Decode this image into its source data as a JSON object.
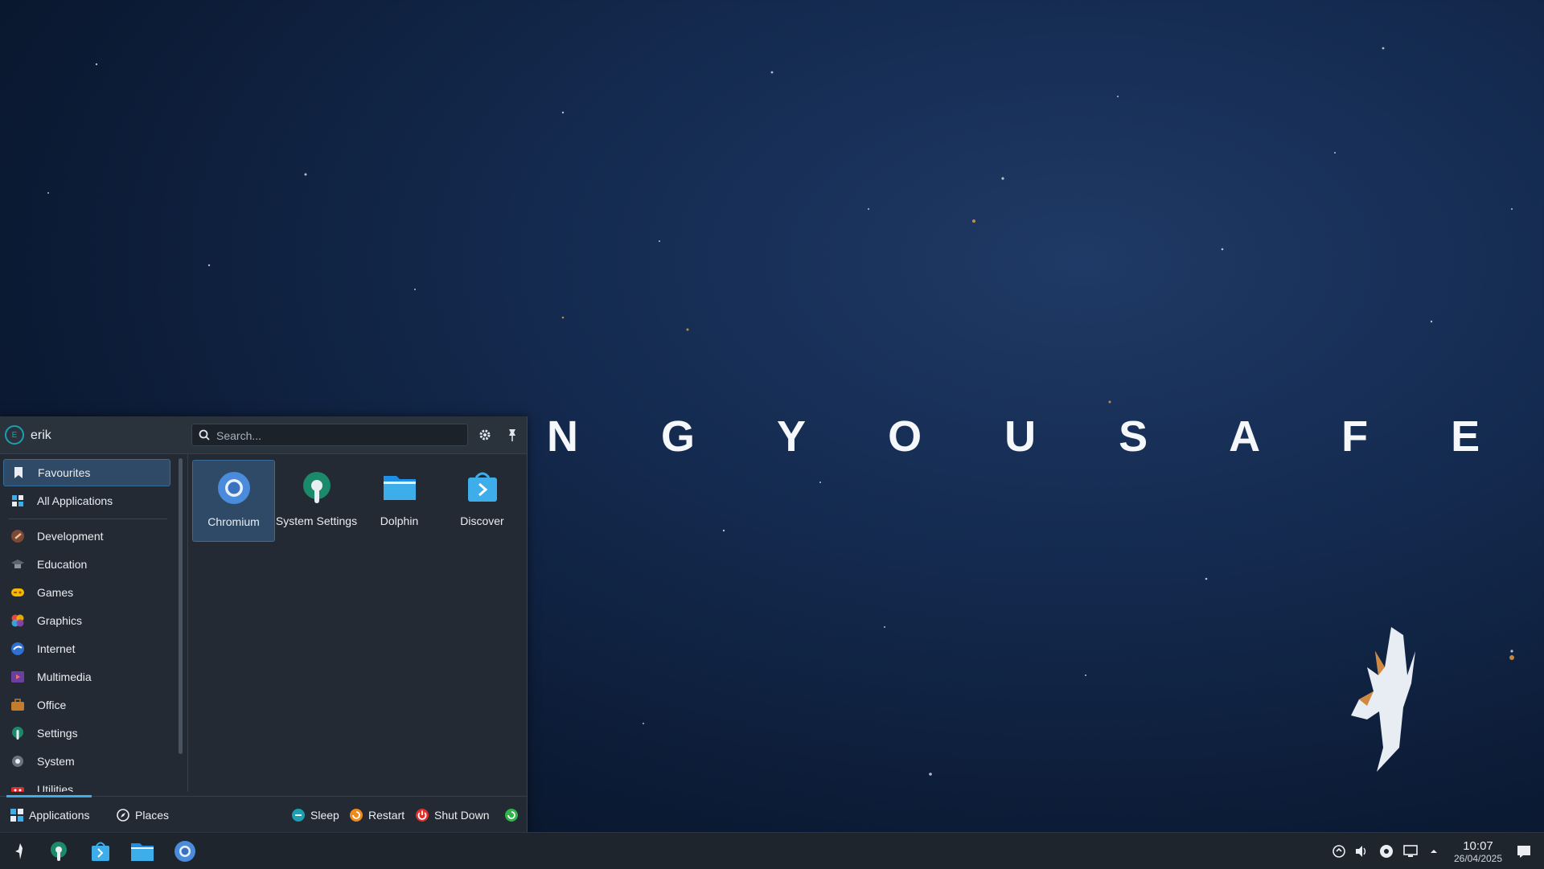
{
  "wallpaper": {
    "text": "N G   Y O U   S A F E"
  },
  "launcher": {
    "user": {
      "name": "erik",
      "avatar_initial": "E"
    },
    "search": {
      "placeholder": "Search..."
    },
    "categories": [
      {
        "label": "Favourites",
        "icon": "bookmark-icon",
        "active": true
      },
      {
        "label": "All Applications",
        "icon": "grid-icon"
      },
      {
        "label": "Development",
        "icon": "hammer-icon"
      },
      {
        "label": "Education",
        "icon": "graduation-cap-icon"
      },
      {
        "label": "Games",
        "icon": "gamepad-icon"
      },
      {
        "label": "Graphics",
        "icon": "color-palette-icon"
      },
      {
        "label": "Internet",
        "icon": "globe-icon"
      },
      {
        "label": "Multimedia",
        "icon": "multimedia-icon"
      },
      {
        "label": "Office",
        "icon": "briefcase-icon"
      },
      {
        "label": "Settings",
        "icon": "settings-wrench-icon"
      },
      {
        "label": "System",
        "icon": "system-icon"
      },
      {
        "label": "Utilities",
        "icon": "toolbox-icon"
      }
    ],
    "favourites": [
      {
        "label": "Chromium",
        "icon": "chromium-icon",
        "active": true
      },
      {
        "label": "System Settings",
        "icon": "system-settings-icon"
      },
      {
        "label": "Dolphin",
        "icon": "folder-icon"
      },
      {
        "label": "Discover",
        "icon": "discover-bag-icon"
      }
    ],
    "footer": {
      "tabs": [
        {
          "label": "Applications",
          "active": true
        },
        {
          "label": "Places"
        }
      ],
      "actions": [
        {
          "label": "Sleep",
          "icon": "sleep-icon"
        },
        {
          "label": "Restart",
          "icon": "restart-icon"
        },
        {
          "label": "Shut Down",
          "icon": "power-icon"
        }
      ]
    }
  },
  "taskbar": {
    "clock": {
      "time": "10:07",
      "date": "26/04/2025"
    },
    "accent": "#3daee9"
  }
}
